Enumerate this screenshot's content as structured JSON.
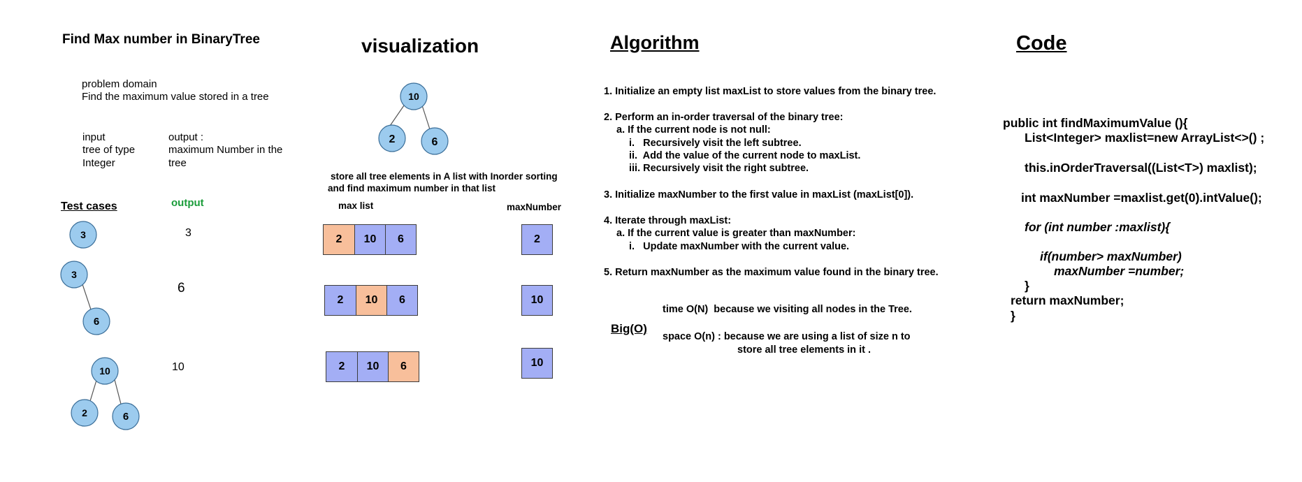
{
  "title": "Find Max number in BinaryTree",
  "problem_domain": {
    "label": "problem domain",
    "text": "Find the maximum value stored in a tree"
  },
  "io": {
    "input_label": "input",
    "input_line1": "tree of type",
    "input_line2": "Integer",
    "output_label": "output :",
    "output_line1": "maximum Number in the",
    "output_line2": "tree"
  },
  "test_cases": {
    "label": "Test cases",
    "output_label": "output",
    "outputs": [
      "3",
      "6",
      "10"
    ],
    "trees": [
      {
        "nodes": [
          "3"
        ]
      },
      {
        "nodes": [
          "3",
          "6"
        ]
      },
      {
        "nodes": [
          "10",
          "2",
          "6"
        ]
      }
    ]
  },
  "visualization": {
    "title": "visualization",
    "tree_nodes": [
      "10",
      "2",
      "6"
    ],
    "note_line1": "store all tree elements in A list with Inorder sorting",
    "note_line2": "and find maximum number in that list",
    "max_list_label": "max list",
    "max_number_label": "maxNumber",
    "rows": [
      {
        "list": [
          "2",
          "10",
          "6"
        ],
        "highlight": 0,
        "max": "2"
      },
      {
        "list": [
          "2",
          "10",
          "6"
        ],
        "highlight": 1,
        "max": "10"
      },
      {
        "list": [
          "2",
          "10",
          "6"
        ],
        "highlight": 2,
        "max": "10"
      }
    ]
  },
  "algorithm": {
    "title": "Algorithm",
    "lines": [
      "1. Initialize an empty list maxList to store values from the binary tree.",
      "2. Perform an in-order traversal of the binary tree:",
      "a. If the current node is not null:",
      "i.   Recursively visit the left subtree.",
      "ii.  Add the value of the current node to maxList.",
      "iii. Recursively visit the right subtree.",
      "3. Initialize maxNumber to the first value in maxList (maxList[0]).",
      "4. Iterate through maxList:",
      "a. If the current value is greater than maxNumber:",
      "i.   Update maxNumber with the current value.",
      "5. Return maxNumber as the maximum value found in the binary tree."
    ]
  },
  "big_o": {
    "label": "Big(O)",
    "time": "time O(N)  because we visiting all nodes in the Tree.",
    "space_line1": "space O(n) : because we are using a list of size n to",
    "space_line2": "store all tree elements in it ."
  },
  "code": {
    "title": "Code",
    "lines": [
      "public int findMaximumValue (){",
      "List<Integer> maxlist=new ArrayList<>() ;",
      "this.inOrderTraversal((List<T>) maxlist);",
      "int maxNumber =maxlist.get(0).intValue();",
      "for (int number :maxlist){",
      "if(number> maxNumber)",
      "maxNumber =number;",
      "}",
      "return maxNumber;",
      "}"
    ]
  },
  "colors": {
    "node_fill": "#9ccbee",
    "list_blue": "#a3aef5",
    "list_orange": "#f8bf9b",
    "output_green": "#1a9c3a"
  }
}
